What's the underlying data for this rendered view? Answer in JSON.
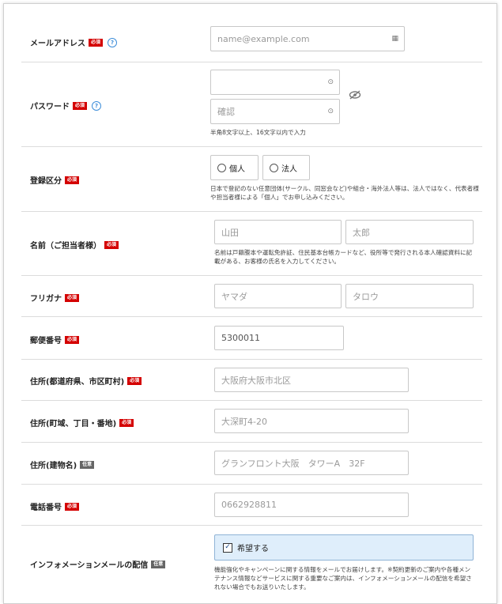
{
  "badges": {
    "required": "必須",
    "optional": "任意"
  },
  "email": {
    "label": "メールアドレス",
    "placeholder": "name@example.com",
    "help": "?"
  },
  "password": {
    "label": "パスワード",
    "help": "?",
    "placeholder": "",
    "confirm_placeholder": "確認",
    "note": "半角8文字以上、16文字以内で入力"
  },
  "category": {
    "label": "登録区分",
    "options": [
      "個人",
      "法人"
    ],
    "note": "日本で登記のない任意団体(サークル、同窓会など)や組合・海外法人等は、法人ではなく、代表者様や担当者様による「個人」でお申し込みください。"
  },
  "name": {
    "label": "名前（ご担当者様）",
    "last_placeholder": "山田",
    "first_placeholder": "太郎",
    "note": "名前は戸籍謄本や運転免許証、住民基本台帳カードなど、役所等で発行される本人確認資料に記載がある、お客様の氏名を入力してください。"
  },
  "kana": {
    "label": "フリガナ",
    "last_placeholder": "ヤマダ",
    "first_placeholder": "タロウ"
  },
  "postal": {
    "label": "郵便番号",
    "value": "5300011"
  },
  "addr1": {
    "label": "住所(都道府県、市区町村)",
    "placeholder": "大阪府大阪市北区"
  },
  "addr2": {
    "label": "住所(町域、丁目・番地)",
    "placeholder": "大深町4-20"
  },
  "addr3": {
    "label": "住所(建物名)",
    "placeholder": "グランフロント大阪　タワーA　32F"
  },
  "phone": {
    "label": "電話番号",
    "placeholder": "0662928811"
  },
  "newsletter": {
    "label": "インフォメーションメールの配信",
    "checkbox_label": "希望する",
    "checked": true,
    "note": "機能強化やキャンペーンに関する情報をメールでお届けします。※契約更新のご案内や各種メンテナンス情報などサービスに関する重要なご案内は、インフォメーションメールの配信を希望されない場合でもお送りいたします。"
  }
}
